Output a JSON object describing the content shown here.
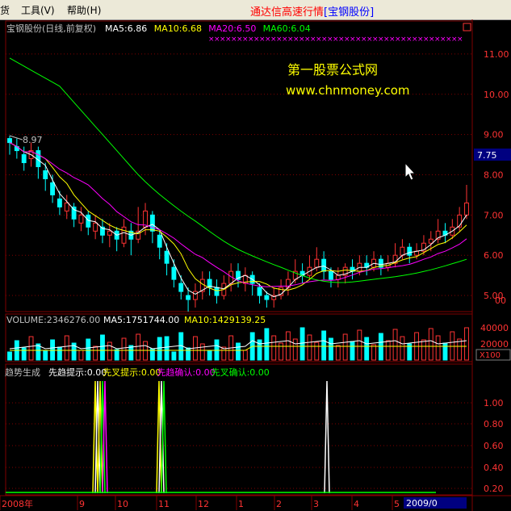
{
  "menu": {
    "items": [
      {
        "label": "货",
        "x": 0
      },
      {
        "label": "工具(V)",
        "x": 26
      },
      {
        "label": "帮助(H)",
        "x": 83
      }
    ],
    "app_title": "通达信高速行情",
    "app_subtitle": "[宝钢股份]"
  },
  "chart_panel": {
    "stock_title": "宝钢股份(日线,前复权)",
    "ma_values": [
      {
        "label": "MA5:6.86",
        "color": "#ffffff"
      },
      {
        "label": "MA10:6.68",
        "color": "#ffff00"
      },
      {
        "label": "MA20:6.50",
        "color": "#ff00ff"
      },
      {
        "label": "MA60:6.04",
        "color": "#00ff00"
      }
    ],
    "watermark_1": "第一股票公式网",
    "watermark_2": "www.chnmoney.com",
    "high_marker": "8.97",
    "current_price": "7.75",
    "price_ticks": [
      "11.00",
      "10.00",
      "9.00",
      "8.00",
      "7.00",
      "6.00",
      "5.00",
      "00"
    ],
    "colors": {
      "up": "#ff3333",
      "down": "#00ffff",
      "ma5": "#ffffff",
      "ma10": "#ffff00",
      "ma20": "#ff00ff",
      "ma60": "#00ff00",
      "grid": "#800000",
      "axis_text": "#ff3333"
    }
  },
  "volume_panel": {
    "label": "VOLUME:2346276.00",
    "ma5": "MA5:1751744.00",
    "ma10": "MA10:1429139.25",
    "ticks": [
      "40000",
      "20000"
    ],
    "unit": "X100"
  },
  "indicator_panel": {
    "labels": [
      {
        "text": "趋势生成",
        "color": "#c0c0c0"
      },
      {
        "text": "先趋提示:0.00",
        "color": "#ffffff"
      },
      {
        "text": "先叉提示:0.00",
        "color": "#ffff00"
      },
      {
        "text": "先趋确认:0.00",
        "color": "#ff00ff"
      },
      {
        "text": "先叉确认:0.00",
        "color": "#00ff00"
      }
    ],
    "ticks": [
      "1.00",
      "0.80",
      "0.60",
      "0.40",
      "0.20"
    ]
  },
  "date_axis": {
    "labels": [
      "2008年",
      "9",
      "10",
      "11",
      "12",
      "1",
      "2",
      "3",
      "4",
      "5"
    ],
    "current_date": "2009/0"
  },
  "chart_data": {
    "type": "candlestick",
    "y_range": [
      4.6,
      11.5
    ],
    "candles_approx": [
      [
        8.9,
        8.8,
        8.97,
        8.5
      ],
      [
        8.7,
        8.6,
        8.9,
        8.4
      ],
      [
        8.5,
        8.3,
        8.7,
        8.1
      ],
      [
        8.4,
        8.6,
        8.8,
        8.2
      ],
      [
        8.6,
        8.2,
        8.7,
        7.9
      ],
      [
        8.1,
        7.9,
        8.3,
        7.6
      ],
      [
        7.8,
        7.5,
        8.0,
        7.3
      ],
      [
        7.4,
        7.2,
        7.6,
        7.0
      ],
      [
        7.1,
        7.3,
        7.5,
        6.9
      ],
      [
        7.2,
        6.9,
        7.3,
        6.7
      ],
      [
        6.8,
        7.0,
        7.2,
        6.6
      ],
      [
        7.0,
        6.7,
        7.1,
        6.5
      ],
      [
        6.6,
        6.8,
        7.0,
        6.4
      ],
      [
        6.7,
        6.5,
        6.9,
        6.3
      ],
      [
        6.5,
        6.6,
        6.8,
        6.2
      ],
      [
        6.6,
        6.4,
        6.7,
        6.1
      ],
      [
        6.3,
        6.7,
        6.9,
        6.2
      ],
      [
        6.6,
        6.4,
        6.8,
        6.0
      ],
      [
        6.4,
        6.6,
        7.2,
        6.3
      ],
      [
        6.7,
        7.1,
        7.3,
        6.5
      ],
      [
        7.0,
        6.6,
        7.1,
        6.3
      ],
      [
        6.5,
        6.2,
        6.6,
        5.9
      ],
      [
        6.1,
        5.8,
        6.3,
        5.5
      ],
      [
        5.7,
        5.4,
        5.9,
        5.2
      ],
      [
        5.3,
        5.1,
        5.5,
        4.9
      ],
      [
        5.0,
        4.9,
        5.2,
        4.6
      ],
      [
        4.9,
        5.1,
        5.3,
        4.7
      ],
      [
        5.1,
        5.4,
        5.6,
        4.9
      ],
      [
        5.4,
        5.2,
        5.6,
        5.0
      ],
      [
        5.2,
        5.0,
        5.4,
        4.8
      ],
      [
        5.0,
        5.3,
        5.5,
        4.9
      ],
      [
        5.3,
        5.6,
        5.8,
        5.1
      ],
      [
        5.6,
        5.4,
        5.8,
        5.2
      ],
      [
        5.3,
        5.5,
        5.7,
        5.1
      ],
      [
        5.5,
        5.3,
        5.6,
        5.0
      ],
      [
        5.2,
        5.0,
        5.3,
        4.8
      ],
      [
        5.0,
        4.9,
        5.1,
        4.7
      ],
      [
        4.9,
        5.0,
        5.2,
        4.7
      ],
      [
        5.0,
        5.2,
        5.4,
        4.9
      ],
      [
        5.2,
        5.4,
        5.6,
        5.0
      ],
      [
        5.4,
        5.6,
        5.9,
        5.3
      ],
      [
        5.6,
        5.5,
        5.8,
        5.3
      ],
      [
        5.5,
        5.7,
        6.0,
        5.4
      ],
      [
        5.7,
        5.9,
        6.2,
        5.6
      ],
      [
        5.9,
        5.6,
        6.1,
        5.4
      ],
      [
        5.6,
        5.4,
        5.7,
        5.2
      ],
      [
        5.4,
        5.5,
        5.7,
        5.2
      ],
      [
        5.5,
        5.7,
        5.8,
        5.3
      ],
      [
        5.7,
        5.6,
        5.9,
        5.4
      ],
      [
        5.6,
        5.8,
        6.0,
        5.5
      ],
      [
        5.8,
        5.7,
        6.0,
        5.5
      ],
      [
        5.7,
        5.9,
        6.1,
        5.6
      ],
      [
        5.9,
        5.7,
        6.0,
        5.5
      ],
      [
        5.7,
        5.8,
        6.0,
        5.6
      ],
      [
        5.8,
        6.0,
        6.3,
        5.7
      ],
      [
        6.0,
        6.2,
        6.4,
        5.9
      ],
      [
        6.2,
        6.0,
        6.3,
        5.8
      ],
      [
        6.0,
        6.1,
        6.3,
        5.9
      ],
      [
        6.1,
        6.3,
        6.5,
        6.0
      ],
      [
        6.3,
        6.4,
        6.6,
        6.1
      ],
      [
        6.4,
        6.6,
        6.9,
        6.3
      ],
      [
        6.6,
        6.5,
        6.8,
        6.3
      ],
      [
        6.5,
        6.7,
        6.9,
        6.4
      ],
      [
        6.7,
        7.0,
        7.2,
        6.6
      ],
      [
        7.0,
        7.3,
        7.75,
        6.9
      ]
    ]
  }
}
